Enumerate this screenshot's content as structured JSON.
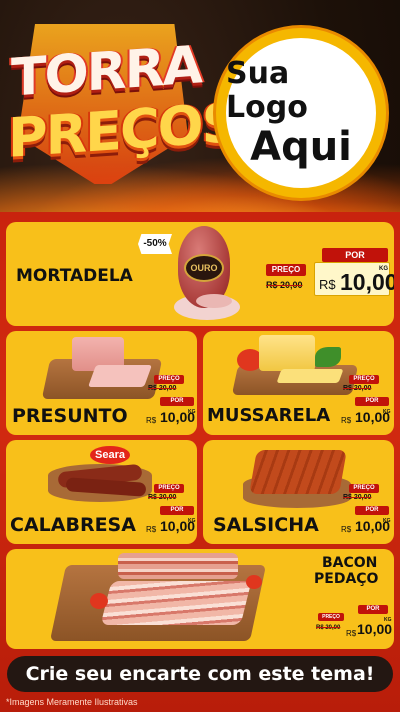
{
  "header": {
    "title_line1": "TORRA",
    "title_line2": "PREÇOS",
    "logo_line1": "Sua Logo",
    "logo_line2": "Aqui"
  },
  "products": {
    "mortadela": {
      "name": "MORTADELA",
      "badge": "-50%",
      "brand": "OURO",
      "preco_label": "PREÇO",
      "old_price": "R$ 20,00",
      "por_label": "POR",
      "currency": "R$",
      "price": "10,00",
      "unit": "KG"
    },
    "presunto": {
      "name": "PRESUNTO",
      "preco_label": "PREÇO",
      "old_price": "R$ 20,00",
      "por_label": "POR",
      "currency": "R$",
      "price": "10,00",
      "unit": "KG"
    },
    "mussarela": {
      "name": "MUSSARELA",
      "preco_label": "PREÇO",
      "old_price": "R$ 20,00",
      "por_label": "POR",
      "currency": "R$",
      "price": "10,00",
      "unit": "KG"
    },
    "calabresa": {
      "name": "CALABRESA",
      "brand": "Seara",
      "preco_label": "PREÇO",
      "old_price": "R$ 20,00",
      "por_label": "POR",
      "currency": "R$",
      "price": "10,00",
      "unit": "KG"
    },
    "salsicha": {
      "name": "SALSICHA",
      "preco_label": "PREÇO",
      "old_price": "R$ 20,00",
      "por_label": "POR",
      "currency": "R$",
      "price": "10,00",
      "unit": "KG"
    },
    "bacon": {
      "name_line1": "BACON",
      "name_line2": "PEDAÇO",
      "preco_label": "PREÇO",
      "old_price": "R$ 20,00",
      "por_label": "POR",
      "currency": "R$",
      "price": "10,00",
      "unit": "KG"
    }
  },
  "footer": {
    "cta": "Crie seu encarte com este tema!",
    "disclaimer": "*Imagens Meramente Ilustrativas"
  },
  "colors": {
    "card": "#f8c01a",
    "price_red": "#c1120a",
    "background_red": "#c9230e"
  }
}
